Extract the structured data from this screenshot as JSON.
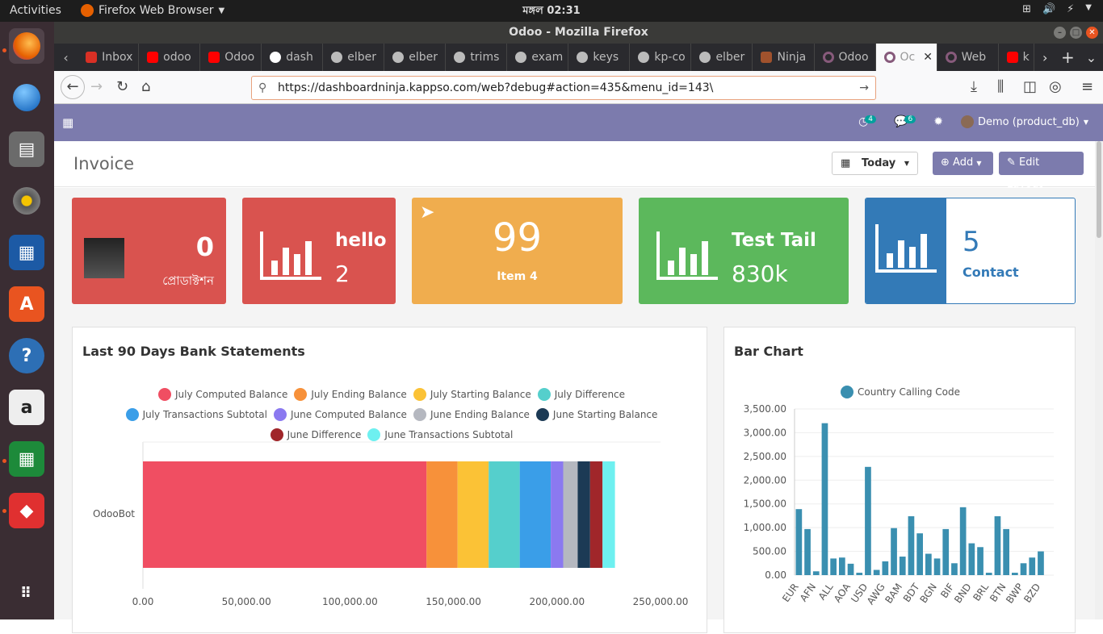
{
  "system": {
    "activities": "Activities",
    "app_name": "Firefox Web Browser",
    "clock": "মঙ্গল 02:31"
  },
  "window": {
    "title": "Odoo - Mozilla Firefox"
  },
  "tabs": [
    {
      "label": "Inbox",
      "color": "#d93025"
    },
    {
      "label": "odoo",
      "color": "#ff0000"
    },
    {
      "label": "Odoo",
      "color": "#ff0000"
    },
    {
      "label": "dash",
      "color": "#4285f4"
    },
    {
      "label": "elber",
      "color": "#bbbbbb"
    },
    {
      "label": "elber",
      "color": "#bbbbbb"
    },
    {
      "label": "trims",
      "color": "#bbbbbb"
    },
    {
      "label": "exam",
      "color": "#bbbbbb"
    },
    {
      "label": "keys",
      "color": "#bbbbbb"
    },
    {
      "label": "kp-co",
      "color": "#bbbbbb"
    },
    {
      "label": "elber",
      "color": "#bbbbbb"
    },
    {
      "label": "Ninja",
      "color": "#a0522d"
    },
    {
      "label": "Odoo",
      "color": "#875a7b"
    },
    {
      "label": "Oc",
      "color": "#875a7b"
    },
    {
      "label": "Web",
      "color": "#875a7b"
    },
    {
      "label": "k",
      "color": "#ff0000"
    }
  ],
  "url": "https://dashboardninja.kappso.com/web?debug#action=435&menu_id=143\\",
  "odoo_header": {
    "activity_count": "4",
    "message_count": "6",
    "user": "Demo (product_db)"
  },
  "control_panel": {
    "title": "Invoice",
    "date_filter": "Today",
    "add_label": "Add",
    "edit_label": "Edit Layout"
  },
  "tiles": [
    {
      "value": "0",
      "label": "প্রোডাক্টশন",
      "color": "#d9534f"
    },
    {
      "title": "hello",
      "value": "2",
      "color": "#d9534f"
    },
    {
      "value": "99",
      "label": "Item 4",
      "color": "#f0ad4e"
    },
    {
      "title": "Test Tail",
      "value": "830k",
      "color": "#5cb85c"
    },
    {
      "value": "5",
      "label": "Contact",
      "color": "#337ab7"
    }
  ],
  "bank_chart": {
    "title": "Last 90 Days Bank Statements",
    "chart_data": {
      "type": "bar",
      "orientation": "horizontal-stacked",
      "categories": [
        "OdooBot"
      ],
      "series": [
        {
          "name": "July Computed Balance",
          "values": [
            137000
          ],
          "color": "#f04e62"
        },
        {
          "name": "July Ending Balance",
          "values": [
            15000
          ],
          "color": "#f7913a"
        },
        {
          "name": "July Starting Balance",
          "values": [
            15000
          ],
          "color": "#fbc236"
        },
        {
          "name": "July Difference",
          "values": [
            15000
          ],
          "color": "#55cfcc"
        },
        {
          "name": "July Transactions Subtotal",
          "values": [
            15000
          ],
          "color": "#3a9ee8"
        },
        {
          "name": "June Computed Balance",
          "values": [
            6000
          ],
          "color": "#8b79f0"
        },
        {
          "name": "June Ending Balance",
          "values": [
            7000
          ],
          "color": "#b5b8c0"
        },
        {
          "name": "June Starting Balance",
          "values": [
            6000
          ],
          "color": "#1c3a55"
        },
        {
          "name": "June Difference",
          "values": [
            6000
          ],
          "color": "#a0262a"
        },
        {
          "name": "June Transactions Subtotal",
          "values": [
            6000
          ],
          "color": "#6ef0f0"
        }
      ],
      "x_ticks": [
        "0.00",
        "50,000.00",
        "100,000.00",
        "150,000.00",
        "200,000.00",
        "250,000.00"
      ],
      "xlim": [
        0,
        250000
      ]
    }
  },
  "bar_chart": {
    "title": "Bar Chart",
    "chart_data": {
      "type": "bar",
      "series_name": "Country Calling Code",
      "color": "#3a8fb0",
      "categories": [
        "EUR",
        "",
        "AFN",
        "",
        "ALL",
        "",
        "AOA",
        "",
        "USD",
        "",
        "AWG",
        "",
        "BAM",
        "",
        "BDT",
        "",
        "BGN",
        "",
        "BIF",
        "",
        "BND",
        "",
        "BRL",
        "",
        "BTN",
        "",
        "BWP",
        "",
        "BZD",
        ""
      ],
      "values": [
        1390,
        970,
        80,
        3200,
        350,
        370,
        240,
        50,
        2280,
        110,
        290,
        990,
        390,
        1240,
        880,
        450,
        350,
        970,
        250,
        1430,
        670,
        590,
        50,
        1240,
        970,
        50,
        250,
        370,
        500,
        0
      ],
      "y_ticks": [
        "0.00",
        "500.00",
        "1,000.00",
        "1,500.00",
        "2,000.00",
        "2,500.00",
        "3,000.00",
        "3,500.00"
      ],
      "ylim": [
        0,
        3500
      ]
    }
  }
}
